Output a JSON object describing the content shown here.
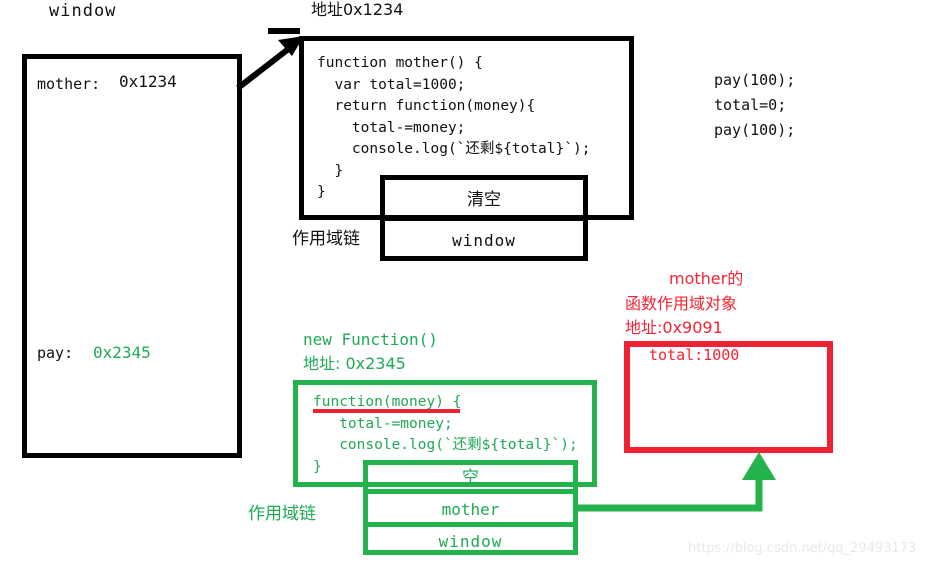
{
  "labels": {
    "window_title": "window",
    "mother_addr_label": "地址0x1234",
    "scope_chain_black": "作用域链",
    "scope_chain_green": "作用域链",
    "new_function_label": "new Function()",
    "new_function_addr": "地址: 0x2345",
    "red_title_line1": "mother的",
    "red_title_line2": "函数作用域对象",
    "red_title_line3": "地址:0x9091"
  },
  "window_box": {
    "entries": [
      {
        "key": "mother:",
        "value": "0x1234",
        "value_color": "black"
      },
      {
        "key": "pay:",
        "value": "0x2345",
        "value_color": "green"
      }
    ]
  },
  "mother_code": {
    "lines": [
      "function mother() {",
      "  var total=1000;",
      "  return function(money){",
      "    total-=money;",
      "    console.log(`还剩${total}`);",
      "  }",
      "}"
    ]
  },
  "mother_scope_chain": {
    "rows": [
      "清空",
      "window"
    ]
  },
  "call_snippet": {
    "lines": [
      "pay(100);",
      "total=0;",
      "pay(100);"
    ]
  },
  "pay_code": {
    "lines": [
      "function(money) {",
      "   total-=money;",
      "   console.log(`还剩${total}`);",
      "}"
    ]
  },
  "pay_scope_chain": {
    "rows": [
      "空",
      "mother",
      "window"
    ]
  },
  "mother_scope_object": {
    "entries": [
      {
        "key": "total",
        "value": "1000",
        "text": "total:1000"
      }
    ]
  },
  "watermark": {
    "text": "https://blog.csdn.net/qq_29493173"
  },
  "colors": {
    "black": "#000000",
    "green": "#23b24b",
    "red": "#ee2233",
    "watermark": "#e9e9e9"
  }
}
